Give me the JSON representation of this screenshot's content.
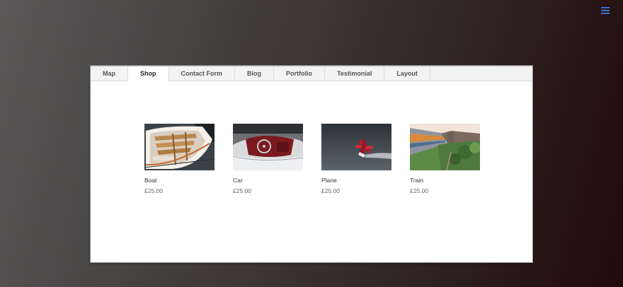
{
  "header": {
    "menu_icon": "hamburger-menu-icon",
    "menu_color": "#3b82f6"
  },
  "tabs": [
    {
      "label": "Map",
      "active": false
    },
    {
      "label": "Shop",
      "active": true
    },
    {
      "label": "Contact Form",
      "active": false
    },
    {
      "label": "Blog",
      "active": false
    },
    {
      "label": "Portfolio",
      "active": false
    },
    {
      "label": "Testimonial",
      "active": false
    },
    {
      "label": "Layout",
      "active": false
    }
  ],
  "products": [
    {
      "name": "Boat",
      "price": "£25.00",
      "image": "boat-image"
    },
    {
      "name": "Car",
      "price": "£25.00",
      "image": "car-image"
    },
    {
      "name": "Plane",
      "price": "£25.00",
      "image": "plane-image"
    },
    {
      "name": "Train",
      "price": "£25.00",
      "image": "train-image"
    }
  ]
}
